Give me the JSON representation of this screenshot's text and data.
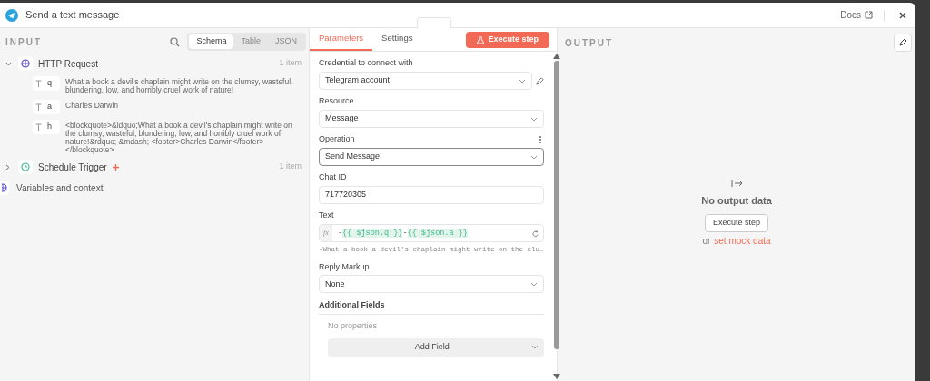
{
  "window": {
    "title": "Send a text message",
    "docs_link": "Docs"
  },
  "input": {
    "title": "INPUT",
    "tabs": [
      {
        "label": "Schema",
        "selected": true
      },
      {
        "label": "Table",
        "selected": false
      },
      {
        "label": "JSON",
        "selected": false
      }
    ],
    "nodes": [
      {
        "kind": "http",
        "name": "HTTP Request",
        "count": "1 item",
        "expanded": true,
        "pinned": false,
        "fields": [
          {
            "key": "q",
            "value": "What a book a devil's chaplain might write on the clumsy, wasteful, blundering, low, and horribly cruel work of nature!"
          },
          {
            "key": "a",
            "value": "Charles Darwin"
          },
          {
            "key": "h",
            "value": "<blockquote>&ldquo;What a book a devil's chaplain might write on the clumsy, wasteful, blundering, low, and horribly cruel work of nature!&rdquo; &mdash; <footer>Charles Darwin</footer> </blockquote>"
          }
        ]
      },
      {
        "kind": "schedule",
        "name": "Schedule Trigger",
        "count": "1 item",
        "expanded": false,
        "pinned": true
      }
    ],
    "variables": "Variables and context"
  },
  "parameters": {
    "tabs": [
      {
        "label": "Parameters",
        "selected": true
      },
      {
        "label": "Settings",
        "selected": false
      }
    ],
    "execute_button": "Execute step",
    "fields": [
      {
        "kind": "credential",
        "label": "Credential to connect with",
        "value": "Telegram account"
      },
      {
        "kind": "select",
        "label": "Resource",
        "value": "Message",
        "focused": false
      },
      {
        "kind": "select",
        "label": "Operation",
        "value": "Send Message",
        "focused": true
      },
      {
        "kind": "input",
        "label": "Chat ID",
        "value": "717720305"
      },
      {
        "kind": "expression",
        "label": "Text",
        "prefix": "fx",
        "parts": [
          "-",
          "{{ $json.q }}",
          "-",
          "{{ $json.a }}"
        ],
        "preview": "-What a book a devil's chaplain might write on the clu…"
      },
      {
        "kind": "select",
        "label": "Reply Markup",
        "value": "None",
        "focused": false
      },
      {
        "kind": "collection",
        "label": "Additional Fields",
        "empty": "No properties",
        "button": "Add Field"
      }
    ]
  },
  "output": {
    "title": "OUTPUT",
    "empty_title": "No output data",
    "button": "Execute step",
    "or": "or",
    "link": "set mock data"
  }
}
